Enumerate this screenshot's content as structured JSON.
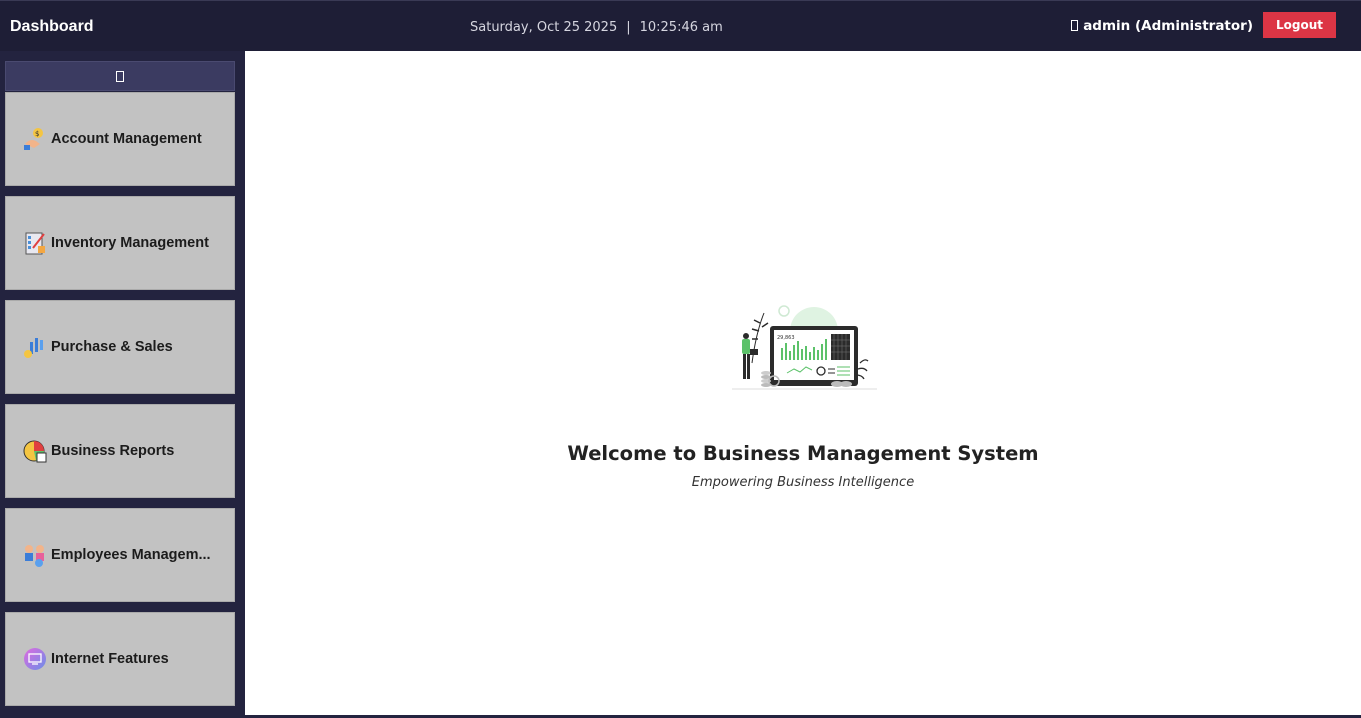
{
  "header": {
    "title": "Dashboard",
    "date": "Saturday, Oct 25 2025",
    "separator": "|",
    "time": "10:25:46 am",
    "user": "admin (Administrator)",
    "logout_label": "Logout"
  },
  "sidebar": {
    "toggle_icon": "menu-toggle-icon",
    "items": [
      {
        "label": "Account Management",
        "icon": "account-management-icon"
      },
      {
        "label": "Inventory Management",
        "icon": "inventory-management-icon"
      },
      {
        "label": "Purchase & Sales",
        "icon": "purchase-sales-icon"
      },
      {
        "label": "Business Reports",
        "icon": "business-reports-icon"
      },
      {
        "label": "Employees Managem...",
        "icon": "employees-management-icon"
      },
      {
        "label": "Internet Features",
        "icon": "internet-features-icon"
      }
    ]
  },
  "main": {
    "illustration": "business-analytics-illustration",
    "welcome_title": "Welcome to Business Management System",
    "welcome_subtitle": "Empowering Business Intelligence"
  },
  "colors": {
    "topbar": "#1e1e36",
    "sidebar": "#23233f",
    "nav_item": "#c2c2c2",
    "logout": "#dc3545",
    "accent_green": "#5cc26a"
  }
}
